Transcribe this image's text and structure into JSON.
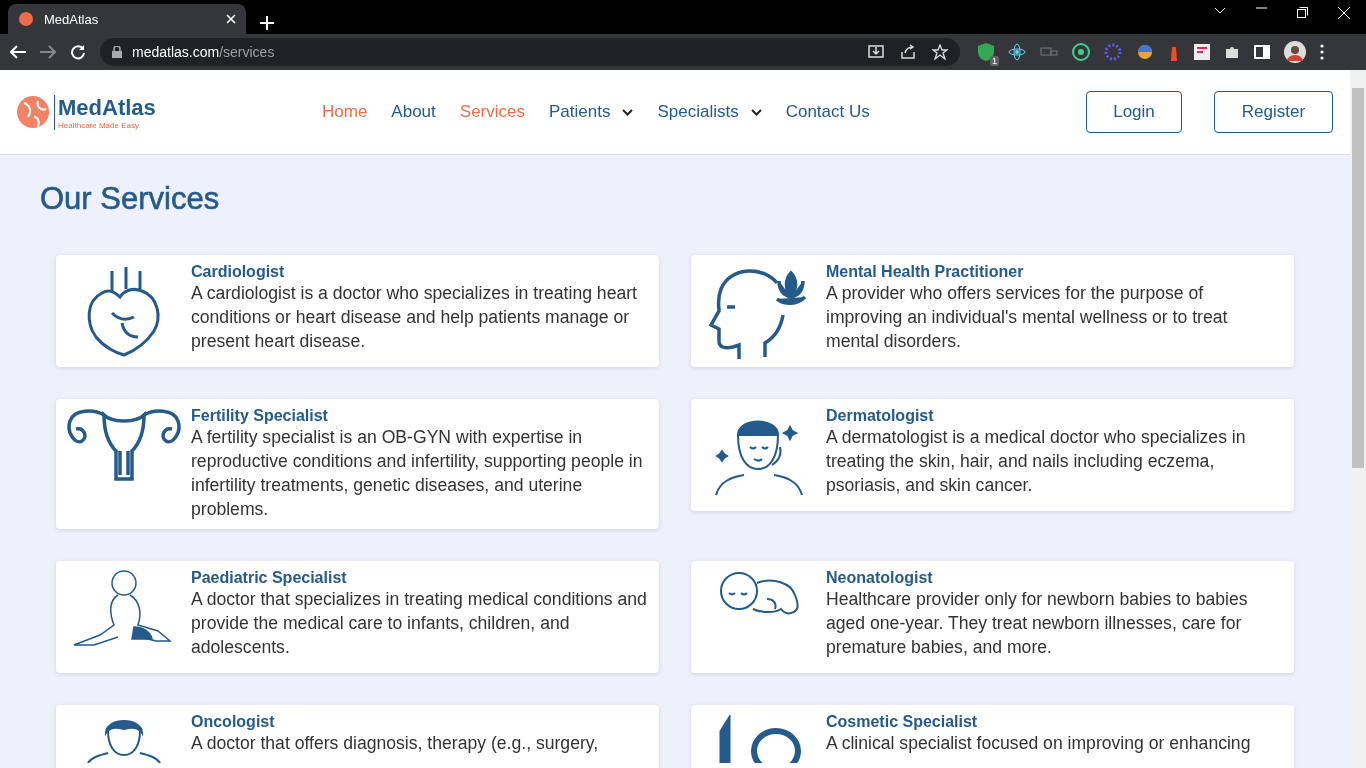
{
  "browser": {
    "tab_title": "MedAtlas",
    "url_host": "medatlas.com",
    "url_path": "/services",
    "extension_badge": "1"
  },
  "header": {
    "logo": {
      "name": "MedAtlas",
      "tagline": "Healthcare Made Easy"
    },
    "nav": [
      {
        "label": "Home",
        "kind": "link",
        "highlighted": true
      },
      {
        "label": "About",
        "kind": "link",
        "highlighted": false
      },
      {
        "label": "Services",
        "kind": "link",
        "highlighted": true
      },
      {
        "label": "Patients",
        "kind": "dropdown",
        "highlighted": false
      },
      {
        "label": "Specialists",
        "kind": "dropdown",
        "highlighted": false
      },
      {
        "label": "Contact Us",
        "kind": "link",
        "highlighted": false
      }
    ],
    "buttons": [
      "Login",
      "Register"
    ]
  },
  "page_title": "Our Services",
  "services": [
    {
      "title": "Cardiologist",
      "description": "A cardiologist is a doctor who specializes in treating heart conditions or heart disease and help patients manage or present heart disease."
    },
    {
      "title": "Mental Health Practitioner",
      "description": "A provider who offers services for the purpose of improving an individual's mental wellness or to treat mental disorders."
    },
    {
      "title": "Fertility Specialist",
      "description": "A fertility specialist is an OB-GYN with expertise in reproductive conditions and infertility, supporting people in infertility treatments, genetic diseases, and uterine problems."
    },
    {
      "title": "Dermatologist",
      "description": "A dermatologist is a medical doctor who specializes in treating the skin, hair, and nails including eczema, psoriasis, and skin cancer."
    },
    {
      "title": "Paediatric Specialist",
      "description": "A doctor that specializes in treating medical conditions and provide the medical care to infants, children, and adolescents."
    },
    {
      "title": "Neonatologist",
      "description": "Healthcare provider only for newborn babies to babies aged one-year. They treat newborn illnesses, care for premature babies, and more."
    },
    {
      "title": "Oncologist",
      "description": "A doctor that offers diagnosis, therapy (e.g., surgery,"
    },
    {
      "title": "Cosmetic Specialist",
      "description": "A clinical specialist focused on improving or enhancing"
    }
  ]
}
